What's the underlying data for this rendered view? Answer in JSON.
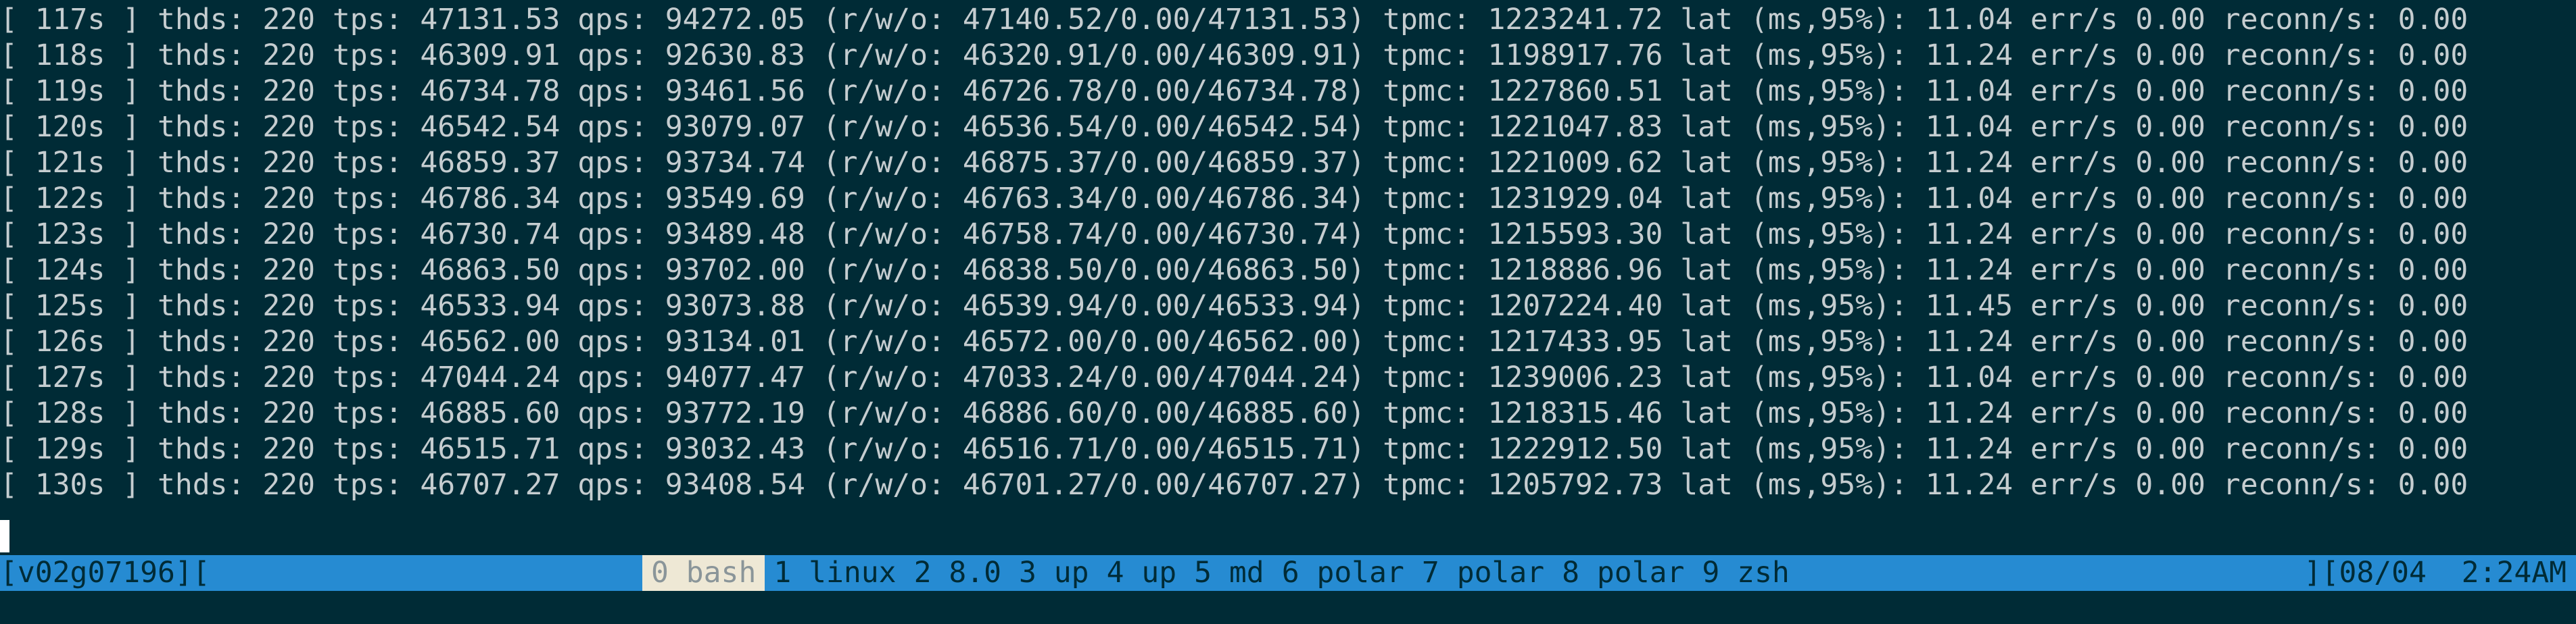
{
  "terminal": {
    "lines": [
      "[ 117s ] thds: 220 tps: 47131.53 qps: 94272.05 (r/w/o: 47140.52/0.00/47131.53) tpmc: 1223241.72 lat (ms,95%): 11.04 err/s 0.00 reconn/s: 0.00",
      "[ 118s ] thds: 220 tps: 46309.91 qps: 92630.83 (r/w/o: 46320.91/0.00/46309.91) tpmc: 1198917.76 lat (ms,95%): 11.24 err/s 0.00 reconn/s: 0.00",
      "[ 119s ] thds: 220 tps: 46734.78 qps: 93461.56 (r/w/o: 46726.78/0.00/46734.78) tpmc: 1227860.51 lat (ms,95%): 11.04 err/s 0.00 reconn/s: 0.00",
      "[ 120s ] thds: 220 tps: 46542.54 qps: 93079.07 (r/w/o: 46536.54/0.00/46542.54) tpmc: 1221047.83 lat (ms,95%): 11.04 err/s 0.00 reconn/s: 0.00",
      "[ 121s ] thds: 220 tps: 46859.37 qps: 93734.74 (r/w/o: 46875.37/0.00/46859.37) tpmc: 1221009.62 lat (ms,95%): 11.24 err/s 0.00 reconn/s: 0.00",
      "[ 122s ] thds: 220 tps: 46786.34 qps: 93549.69 (r/w/o: 46763.34/0.00/46786.34) tpmc: 1231929.04 lat (ms,95%): 11.04 err/s 0.00 reconn/s: 0.00",
      "[ 123s ] thds: 220 tps: 46730.74 qps: 93489.48 (r/w/o: 46758.74/0.00/46730.74) tpmc: 1215593.30 lat (ms,95%): 11.24 err/s 0.00 reconn/s: 0.00",
      "[ 124s ] thds: 220 tps: 46863.50 qps: 93702.00 (r/w/o: 46838.50/0.00/46863.50) tpmc: 1218886.96 lat (ms,95%): 11.24 err/s 0.00 reconn/s: 0.00",
      "[ 125s ] thds: 220 tps: 46533.94 qps: 93073.88 (r/w/o: 46539.94/0.00/46533.94) tpmc: 1207224.40 lat (ms,95%): 11.45 err/s 0.00 reconn/s: 0.00",
      "[ 126s ] thds: 220 tps: 46562.00 qps: 93134.01 (r/w/o: 46572.00/0.00/46562.00) tpmc: 1217433.95 lat (ms,95%): 11.24 err/s 0.00 reconn/s: 0.00",
      "[ 127s ] thds: 220 tps: 47044.24 qps: 94077.47 (r/w/o: 47033.24/0.00/47044.24) tpmc: 1239006.23 lat (ms,95%): 11.04 err/s 0.00 reconn/s: 0.00",
      "[ 128s ] thds: 220 tps: 46885.60 qps: 93772.19 (r/w/o: 46886.60/0.00/46885.60) tpmc: 1218315.46 lat (ms,95%): 11.24 err/s 0.00 reconn/s: 0.00",
      "[ 129s ] thds: 220 tps: 46515.71 qps: 93032.43 (r/w/o: 46516.71/0.00/46515.71) tpmc: 1222912.50 lat (ms,95%): 11.24 err/s 0.00 reconn/s: 0.00",
      "[ 130s ] thds: 220 tps: 46707.27 qps: 93408.54 (r/w/o: 46701.27/0.00/46707.27) tpmc: 1205792.73 lat (ms,95%): 11.24 err/s 0.00 reconn/s: 0.00"
    ]
  },
  "status_bar": {
    "left": "[v02g07196][",
    "windows": [
      {
        "label": "0 bash",
        "active": true
      },
      {
        "label": "1 linux",
        "active": false
      },
      {
        "label": "2 8.0",
        "active": false
      },
      {
        "label": "3 up",
        "active": false
      },
      {
        "label": "4 up",
        "active": false
      },
      {
        "label": "5 md",
        "active": false
      },
      {
        "label": "6 polar",
        "active": false
      },
      {
        "label": "7 polar",
        "active": false
      },
      {
        "label": "8 polar",
        "active": false
      },
      {
        "label": "9 zsh",
        "active": false
      }
    ],
    "right": "][08/04  2:24AM"
  },
  "colors": {
    "background": "#002b36",
    "text": "#c5cdd0",
    "status_bar": "#268bd2",
    "active_window_bg": "#eee8d5"
  }
}
